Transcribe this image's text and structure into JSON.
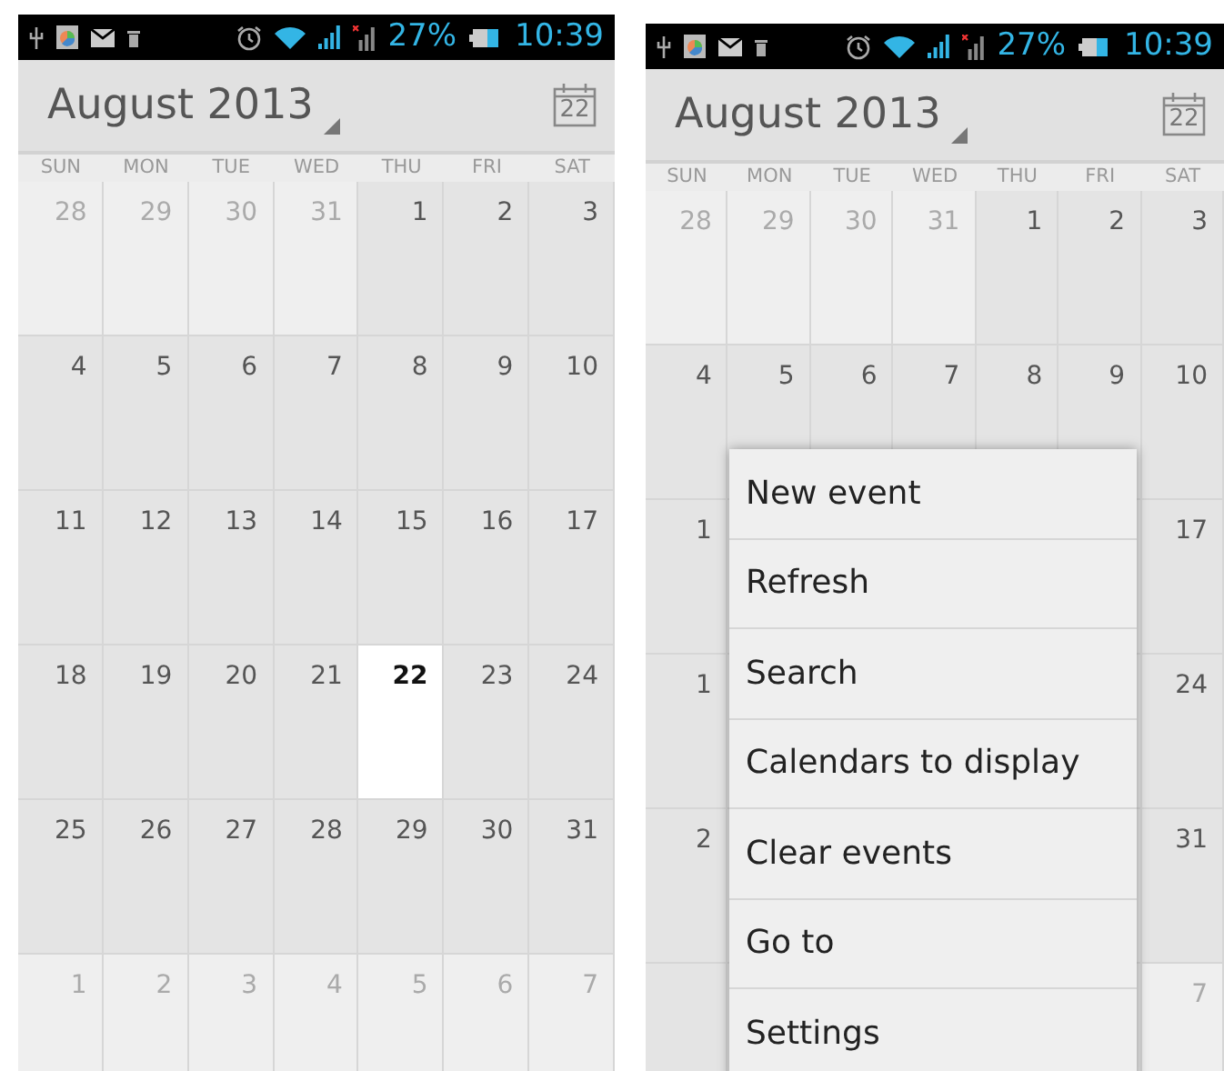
{
  "screens": [
    {
      "status_bar": {
        "battery": "27%",
        "time": "10:39"
      },
      "header": {
        "title": "August 2013",
        "today_label": "22"
      },
      "weekdays": [
        "SUN",
        "MON",
        "TUE",
        "WED",
        "THU",
        "FRI",
        "SAT"
      ],
      "weeks": [
        {
          "days": [
            {
              "label": "28",
              "in_month": false,
              "today": false
            },
            {
              "label": "29",
              "in_month": false,
              "today": false
            },
            {
              "label": "30",
              "in_month": false,
              "today": false
            },
            {
              "label": "31",
              "in_month": false,
              "today": false
            },
            {
              "label": "1",
              "in_month": true,
              "today": false
            },
            {
              "label": "2",
              "in_month": true,
              "today": false
            },
            {
              "label": "3",
              "in_month": true,
              "today": false
            }
          ]
        },
        {
          "days": [
            {
              "label": "4",
              "in_month": true,
              "today": false
            },
            {
              "label": "5",
              "in_month": true,
              "today": false
            },
            {
              "label": "6",
              "in_month": true,
              "today": false
            },
            {
              "label": "7",
              "in_month": true,
              "today": false
            },
            {
              "label": "8",
              "in_month": true,
              "today": false
            },
            {
              "label": "9",
              "in_month": true,
              "today": false
            },
            {
              "label": "10",
              "in_month": true,
              "today": false
            }
          ]
        },
        {
          "days": [
            {
              "label": "11",
              "in_month": true,
              "today": false
            },
            {
              "label": "12",
              "in_month": true,
              "today": false
            },
            {
              "label": "13",
              "in_month": true,
              "today": false
            },
            {
              "label": "14",
              "in_month": true,
              "today": false
            },
            {
              "label": "15",
              "in_month": true,
              "today": false
            },
            {
              "label": "16",
              "in_month": true,
              "today": false
            },
            {
              "label": "17",
              "in_month": true,
              "today": false
            }
          ]
        },
        {
          "days": [
            {
              "label": "18",
              "in_month": true,
              "today": false
            },
            {
              "label": "19",
              "in_month": true,
              "today": false
            },
            {
              "label": "20",
              "in_month": true,
              "today": false
            },
            {
              "label": "21",
              "in_month": true,
              "today": false
            },
            {
              "label": "22",
              "in_month": true,
              "today": true
            },
            {
              "label": "23",
              "in_month": true,
              "today": false
            },
            {
              "label": "24",
              "in_month": true,
              "today": false
            }
          ]
        },
        {
          "days": [
            {
              "label": "25",
              "in_month": true,
              "today": false
            },
            {
              "label": "26",
              "in_month": true,
              "today": false
            },
            {
              "label": "27",
              "in_month": true,
              "today": false
            },
            {
              "label": "28",
              "in_month": true,
              "today": false
            },
            {
              "label": "29",
              "in_month": true,
              "today": false
            },
            {
              "label": "30",
              "in_month": true,
              "today": false
            },
            {
              "label": "31",
              "in_month": true,
              "today": false
            }
          ]
        },
        {
          "days": [
            {
              "label": "1",
              "in_month": false,
              "today": false
            },
            {
              "label": "2",
              "in_month": false,
              "today": false
            },
            {
              "label": "3",
              "in_month": false,
              "today": false
            },
            {
              "label": "4",
              "in_month": false,
              "today": false
            },
            {
              "label": "5",
              "in_month": false,
              "today": false
            },
            {
              "label": "6",
              "in_month": false,
              "today": false
            },
            {
              "label": "7",
              "in_month": false,
              "today": false
            }
          ]
        }
      ]
    },
    {
      "status_bar": {
        "battery": "27%",
        "time": "10:39"
      },
      "header": {
        "title": "August 2013",
        "today_label": "22"
      },
      "weekdays": [
        "SUN",
        "MON",
        "TUE",
        "WED",
        "THU",
        "FRI",
        "SAT"
      ],
      "weeks": [
        {
          "days": [
            {
              "label": "28",
              "in_month": false,
              "today": false
            },
            {
              "label": "29",
              "in_month": false,
              "today": false
            },
            {
              "label": "30",
              "in_month": false,
              "today": false
            },
            {
              "label": "31",
              "in_month": false,
              "today": false
            },
            {
              "label": "1",
              "in_month": true,
              "today": false
            },
            {
              "label": "2",
              "in_month": true,
              "today": false
            },
            {
              "label": "3",
              "in_month": true,
              "today": false
            }
          ]
        },
        {
          "days": [
            {
              "label": "4",
              "in_month": true,
              "today": false
            },
            {
              "label": "5",
              "in_month": true,
              "today": false
            },
            {
              "label": "6",
              "in_month": true,
              "today": false
            },
            {
              "label": "7",
              "in_month": true,
              "today": false
            },
            {
              "label": "8",
              "in_month": true,
              "today": false
            },
            {
              "label": "9",
              "in_month": true,
              "today": false
            },
            {
              "label": "10",
              "in_month": true,
              "today": false
            }
          ]
        },
        {
          "start": {
            "label": "1",
            "in_month": true,
            "today": false
          },
          "end": {
            "label": "17",
            "in_month": true,
            "today": false
          }
        },
        {
          "start": {
            "label": "1",
            "in_month": true,
            "today": false
          },
          "end": {
            "label": "24",
            "in_month": true,
            "today": false
          }
        },
        {
          "start": {
            "label": "2",
            "in_month": true,
            "today": false
          },
          "end": {
            "label": "31",
            "in_month": true,
            "today": false
          }
        },
        {
          "end": {
            "label": "7",
            "in_month": false,
            "today": false
          }
        }
      ],
      "menu": [
        "New event",
        "Refresh",
        "Search",
        "Calendars to display",
        "Clear events",
        "Go to",
        "Settings"
      ]
    }
  ]
}
